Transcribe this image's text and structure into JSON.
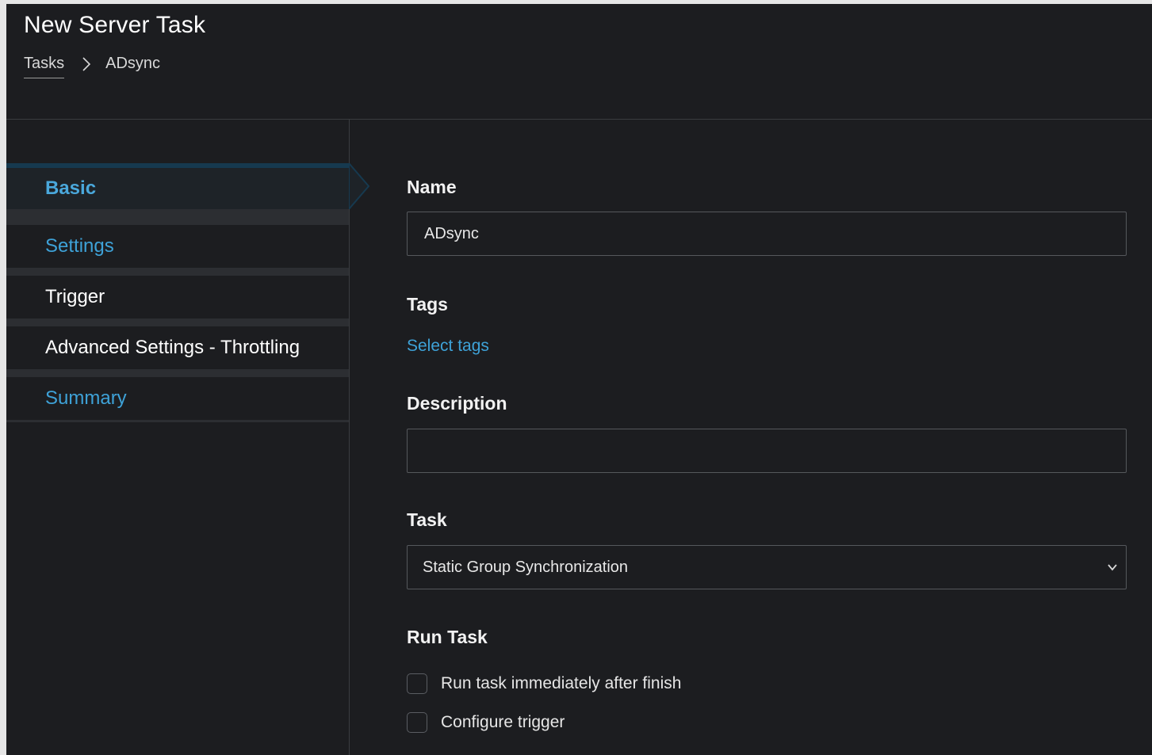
{
  "header": {
    "title": "New Server Task",
    "breadcrumb": {
      "parent": "Tasks",
      "current": "ADsync"
    }
  },
  "sidebar": {
    "items": [
      {
        "label": "Basic",
        "state": "active"
      },
      {
        "label": "Settings",
        "state": "link"
      },
      {
        "label": "Trigger",
        "state": "normal"
      },
      {
        "label": "Advanced Settings - Throttling",
        "state": "normal"
      },
      {
        "label": "Summary",
        "state": "link"
      }
    ]
  },
  "form": {
    "name": {
      "label": "Name",
      "value": "ADsync"
    },
    "tags": {
      "label": "Tags",
      "link": "Select tags"
    },
    "description": {
      "label": "Description",
      "value": ""
    },
    "task": {
      "label": "Task",
      "selected": "Static Group Synchronization"
    },
    "run_task": {
      "label": "Run Task",
      "options": [
        {
          "label": "Run task immediately after finish",
          "checked": false
        },
        {
          "label": "Configure trigger",
          "checked": false
        }
      ]
    }
  },
  "colors": {
    "background": "#1c1d20",
    "accent": "#3ea2d8",
    "border": "#55585c"
  }
}
